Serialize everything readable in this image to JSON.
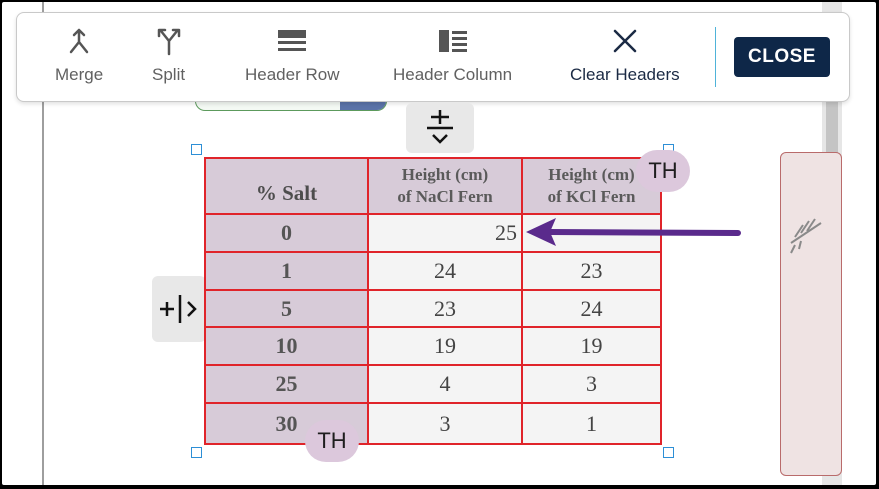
{
  "toolbar": {
    "buttons": [
      {
        "label": "Merge",
        "icon": "merge-icon"
      },
      {
        "label": "Split",
        "icon": "split-icon"
      },
      {
        "label": "Header Row",
        "icon": "header-row-icon"
      },
      {
        "label": "Header Column",
        "icon": "header-column-icon"
      },
      {
        "label": "Clear Headers",
        "icon": "close-icon"
      }
    ],
    "close_label": "CLOSE"
  },
  "table": {
    "headers": [
      "% Salt",
      "Height (cm)",
      "of NaCl Fern",
      "Height (cm)",
      "of KCl Fern"
    ],
    "rows": [
      {
        "salt": "0",
        "nacl": "25",
        "kcl": ""
      },
      {
        "salt": "1",
        "nacl": "24",
        "kcl": "23"
      },
      {
        "salt": "5",
        "nacl": "23",
        "kcl": "24"
      },
      {
        "salt": "10",
        "nacl": "19",
        "kcl": "19"
      },
      {
        "salt": "25",
        "nacl": "4",
        "kcl": "3"
      },
      {
        "salt": "30",
        "nacl": "3",
        "kcl": "1"
      }
    ]
  },
  "badges": {
    "top_right": "TH",
    "bottom": "TH"
  },
  "colors": {
    "close_bg": "#0e2748",
    "cell_border": "#e0242a",
    "header_bg": "#d7cbd8",
    "arrow": "#5a2a8c",
    "selection": "#2d8fd6"
  }
}
